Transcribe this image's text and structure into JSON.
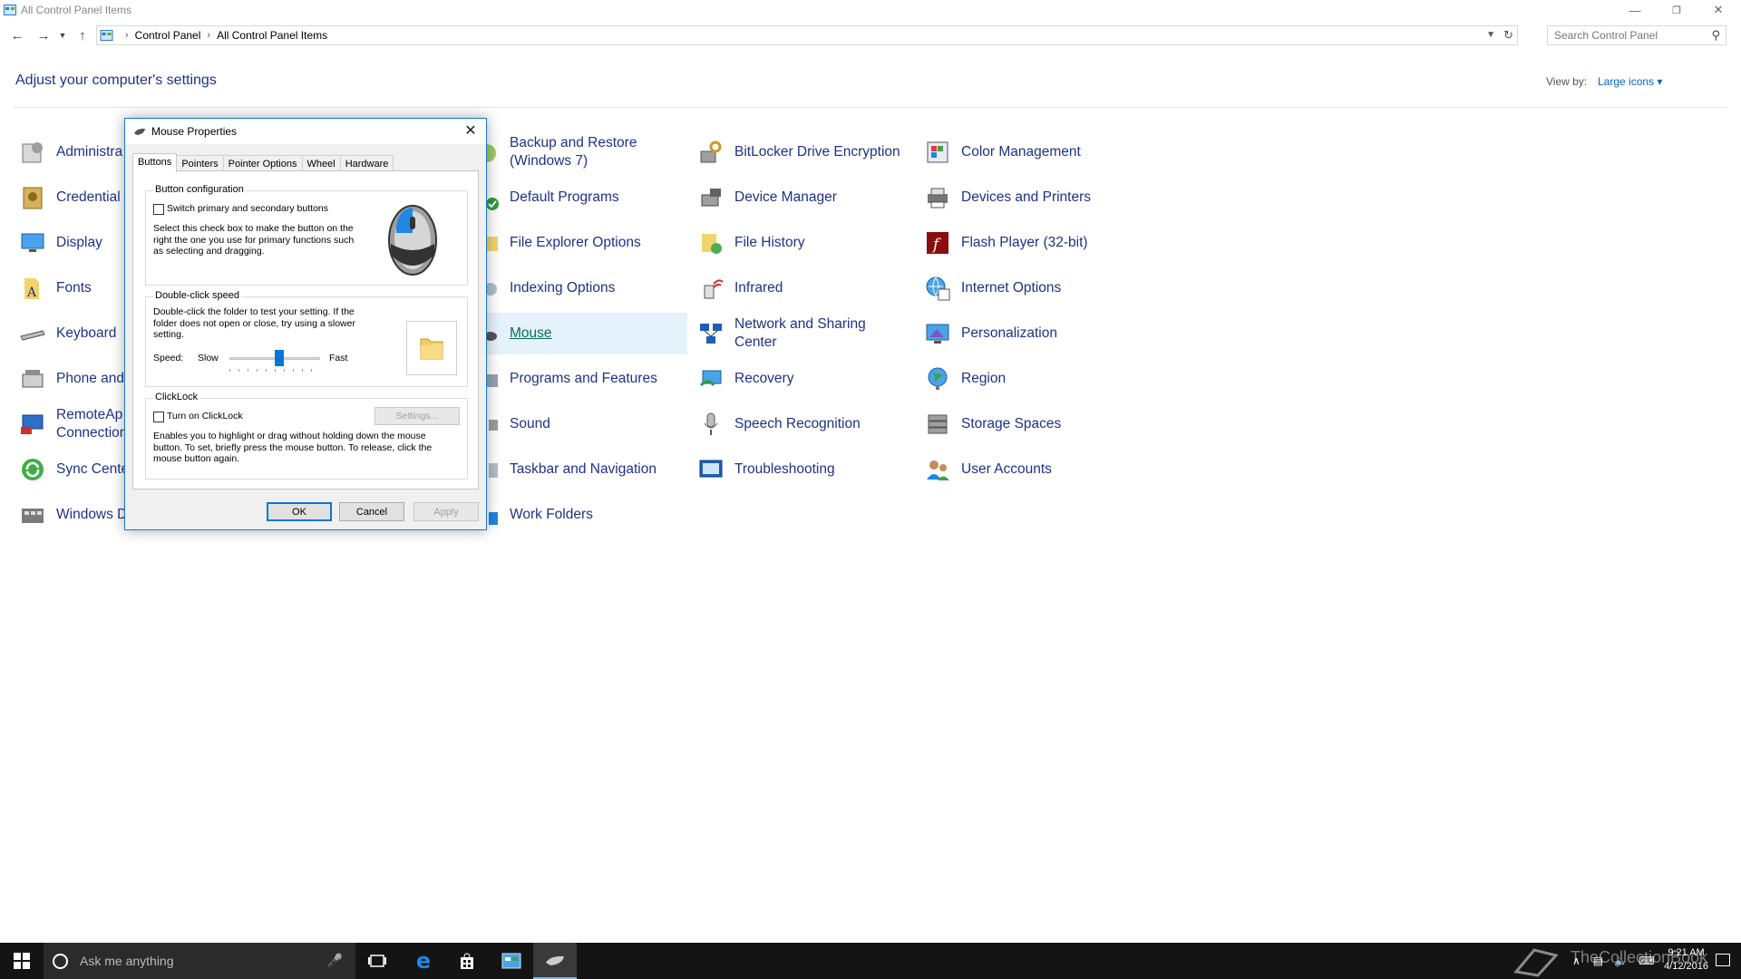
{
  "window": {
    "title": "All Control Panel Items",
    "controls": {
      "minimize": "—",
      "restore": "❐",
      "close": "✕"
    }
  },
  "address": {
    "crumbs": [
      "Control Panel",
      "All Control Panel Items"
    ],
    "search_placeholder": "Search Control Panel"
  },
  "header": {
    "title": "Adjust your computer's settings",
    "view_by_label": "View by:",
    "view_by_value": "Large icons ▾"
  },
  "items": {
    "col1": [
      "Administra",
      "Credential",
      "Display",
      "Fonts",
      "Keyboard",
      "Phone and",
      "RemoteAp\nConnection",
      "Sync Cente",
      "Windows D"
    ],
    "col2": [
      "Backup and Restore\n(Windows 7)",
      "Default Programs",
      "File Explorer Options",
      "Indexing Options",
      "Mouse",
      "Programs and Features",
      "Sound",
      "Taskbar and Navigation",
      "Work Folders"
    ],
    "col3": [
      "BitLocker Drive Encryption",
      "Device Manager",
      "File History",
      "Infrared",
      "Network and Sharing\nCenter",
      "Recovery",
      "Speech Recognition",
      "Troubleshooting"
    ],
    "col4": [
      "Color Management",
      "Devices and Printers",
      "Flash Player (32-bit)",
      "Internet Options",
      "Personalization",
      "Region",
      "Storage Spaces",
      "User Accounts"
    ]
  },
  "dialog": {
    "title": "Mouse Properties",
    "tabs": [
      "Buttons",
      "Pointers",
      "Pointer Options",
      "Wheel",
      "Hardware"
    ],
    "button_config": {
      "title": "Button configuration",
      "checkbox_label": "Switch primary and secondary buttons",
      "checked": false,
      "description": "Select this check box to make the button on the right the one you use for primary functions such as selecting and dragging."
    },
    "double_click": {
      "title": "Double-click speed",
      "description": "Double-click the folder to test your setting. If the folder does not open or close, try using a slower setting.",
      "speed_label": "Speed:",
      "slow_label": "Slow",
      "fast_label": "Fast",
      "slider_value": 0.55
    },
    "clicklock": {
      "title": "ClickLock",
      "checkbox_label": "Turn on ClickLock",
      "checked": false,
      "settings_button": "Settings...",
      "description": "Enables you to highlight or drag without holding down the mouse button. To set, briefly press the mouse button. To release, click the mouse button again."
    },
    "buttons": {
      "ok": "OK",
      "cancel": "Cancel",
      "apply": "Apply"
    }
  },
  "taskbar": {
    "search_text": "Ask me anything",
    "clock_time": "9:21 AM",
    "clock_date": "4/12/2016",
    "watermark": "TheCollectionBook"
  },
  "colors": {
    "link": "#1e3287",
    "accent": "#0078d7",
    "taskbar": "#141414"
  }
}
